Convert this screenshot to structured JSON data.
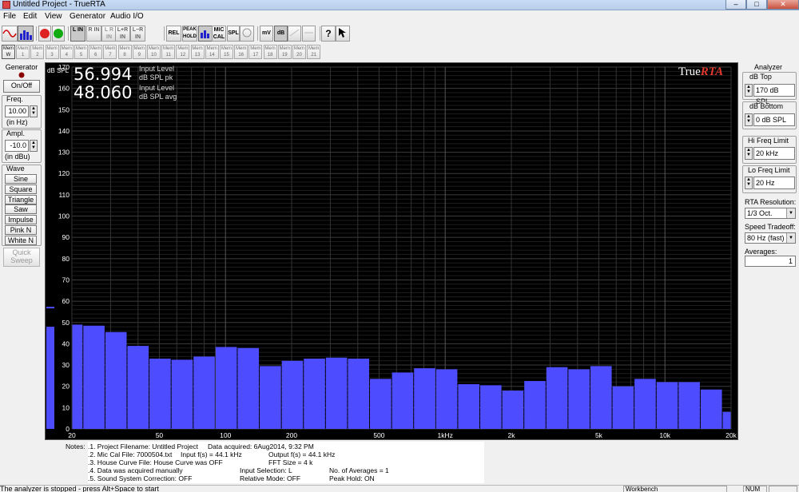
{
  "window": {
    "title": "Untitled Project - TrueRTA",
    "minimize": "–",
    "maximize": "□",
    "close": "✕"
  },
  "menu": [
    "File",
    "Edit",
    "View",
    "Generator",
    "Audio I/O"
  ],
  "toolbar": {
    "buttons": [
      "REL",
      "PEAK HOLD",
      "MIC CAL",
      "SPL",
      "mV",
      "dB",
      "?"
    ],
    "input_buttons": [
      "L IN",
      "R IN",
      "L R IN",
      "L+R IN",
      "L−R IN"
    ],
    "stop_label": "STOP",
    "go_label": "GO"
  },
  "mem_buttons": [
    "Mem W",
    "Mem 1",
    "Mem 2",
    "Mem 3",
    "Mem 4",
    "Mem 5",
    "Mem 6",
    "Mem 7",
    "Mem 8",
    "Mem 9",
    "Mem 10",
    "Mem 11",
    "Mem 12",
    "Mem 13",
    "Mem 14",
    "Mem 15",
    "Mem 16",
    "Mem 17",
    "Mem 18",
    "Mem 19",
    "Mem 20",
    "Mem 21"
  ],
  "generator": {
    "heading": "Generator",
    "on_off": "On/Off",
    "freq_label": "Freq.",
    "freq_value": "10.00",
    "freq_unit": "(in Hz)",
    "ampl_label": "Ampl.",
    "ampl_value": "-10.0",
    "ampl_unit": "(in dBu)",
    "wave_label": "Wave",
    "waves": [
      "Sine",
      "Square",
      "Triangle",
      "Saw",
      "Impulse",
      "Pink N",
      "White N"
    ],
    "quick_sweep": "Quick Sweep"
  },
  "readout": {
    "unit": "dB SPL",
    "peak_value": "56.994",
    "peak_label_1": "Input Level",
    "peak_label_2": "dB SPL pk",
    "avg_value": "48.060",
    "avg_label_1": "Input Level",
    "avg_label_2": "dB SPL avg"
  },
  "brand": {
    "main": "True",
    "accent": "RTA"
  },
  "chart_data": {
    "type": "bar",
    "ylim": [
      0,
      170
    ],
    "ylabel": "dB SPL",
    "x_scale": "log",
    "xlim": [
      20,
      20000
    ],
    "y_ticks": [
      0,
      10,
      20,
      30,
      40,
      50,
      60,
      70,
      80,
      90,
      100,
      110,
      120,
      130,
      140,
      150,
      160,
      170
    ],
    "x_tick_labels": [
      "20",
      "50",
      "100",
      "200",
      "500",
      "1kHz",
      "2k",
      "5k",
      "10k",
      "20k"
    ],
    "x_tick_values": [
      20,
      50,
      100,
      200,
      500,
      1000,
      2000,
      5000,
      10000,
      20000
    ],
    "categories": [
      "20",
      "25",
      "31.5",
      "40",
      "50",
      "63",
      "80",
      "100",
      "125",
      "160",
      "200",
      "250",
      "315",
      "400",
      "500",
      "630",
      "800",
      "1k",
      "1.25k",
      "1.6k",
      "2k",
      "2.5k",
      "3.15k",
      "4k",
      "5k",
      "6.3k",
      "8k",
      "10k",
      "12.5k",
      "16k",
      "20k"
    ],
    "values": [
      49,
      48.5,
      45.5,
      39,
      33,
      32.5,
      34,
      38.5,
      38,
      29.5,
      32,
      33,
      33.5,
      33,
      23.5,
      26.5,
      28.5,
      28,
      21,
      20.5,
      18,
      22.5,
      29,
      28,
      29.5,
      20,
      23.5,
      22,
      22,
      18.5,
      8
    ],
    "side_meters": {
      "peak": 57,
      "avg": 48
    },
    "colors": {
      "bar": "#4d4dff",
      "grid": "#3a3a3a",
      "background": "#000000"
    }
  },
  "analyzer": {
    "heading": "Analyzer",
    "db_top_label": "dB Top",
    "db_top_value": "170 dB SPL",
    "db_bottom_label": "dB Bottom",
    "db_bottom_value": "0 dB SPL",
    "hi_freq_label": "Hi Freq Limit",
    "hi_freq_value": "20 kHz",
    "lo_freq_label": "Lo Freq Limit",
    "lo_freq_value": "20 Hz",
    "rta_res_label": "RTA Resolution:",
    "rta_res_value": "1/3 Oct.",
    "speed_label": "Speed Tradeoff:",
    "speed_value": "80 Hz (fast)",
    "averages_label": "Averages:",
    "averages_value": "1"
  },
  "notes": {
    "label": "Notes:",
    "line1_a": ".1. Project Filename: Untitled Project",
    "line1_b": "Data acquired: 6Aug2014, 9:32 PM",
    "line2_a": ".2. Mic Cal File: 7000504.txt",
    "line2_b": "Input f(s) = 44.1 kHz",
    "line2_c": "Output f(s) = 44.1 kHz",
    "line3_a": ".3. House Curve File: House Curve was OFF",
    "line3_c": "FFT Size = 4 k",
    "line4_a": ".4. Data was acquired manually",
    "line4_b": "Input Selection: L",
    "line4_c": "No. of Averages = 1",
    "line5_a": ".5. Sound System Correction: OFF",
    "line5_b": "Relative Mode: OFF",
    "line5_c": "Peak Hold: ON"
  },
  "status": {
    "message": "The analyzer is stopped - press Alt+Space to start",
    "workbench": "Workbench",
    "num": "NUM"
  }
}
